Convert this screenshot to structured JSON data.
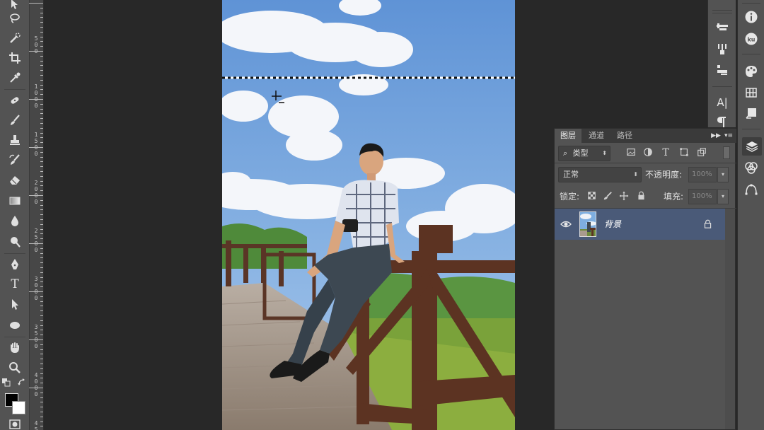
{
  "toolbar": {
    "tools": [
      "move-tool",
      "lasso-tool",
      "quick-selection-tool",
      "crop-tool",
      "eyedropper-tool",
      "spot-healing-tool",
      "brush-tool",
      "clone-stamp-tool",
      "history-brush-tool",
      "eraser-tool",
      "gradient-tool",
      "blur-tool",
      "dodge-tool",
      "pen-tool",
      "type-tool",
      "path-selection-tool",
      "ellipse-tool",
      "hand-tool",
      "zoom-tool"
    ],
    "type_tool_glyph": "T",
    "foreground_color": "#000000",
    "background_color": "#ffffff"
  },
  "ruler": {
    "labels": [
      "5\n0\n0",
      "1\n0\n0\n0",
      "1\n5\n0\n0",
      "2\n0\n0\n0",
      "2\n5\n0\n0",
      "3\n0\n0\n0",
      "3\n5\n0\n0",
      "4\n0\n0\n0",
      "4\n5\n0\n0"
    ]
  },
  "canvas": {
    "selection_marquee": "marching-ants horizontal line",
    "cursor": "crosshair"
  },
  "right_strip": {
    "char_panel_glyph": "A|",
    "info_glyph": "i",
    "kuler_glyph": "ku"
  },
  "layers_panel": {
    "tabs": [
      {
        "label": "图层",
        "active": true
      },
      {
        "label": "通道",
        "active": false
      },
      {
        "label": "路径",
        "active": false
      }
    ],
    "collapse_label": "▶▶",
    "menu_label": "▾≡",
    "filter": {
      "search_glyph": "⌕",
      "kind_label": "类型"
    },
    "filter_icons": [
      "image-filter-icon",
      "adjustment-filter-icon",
      "type-filter-icon",
      "shape-filter-icon",
      "smart-object-filter-icon"
    ],
    "blend_mode": "正常",
    "opacity_label": "不透明度:",
    "opacity_value": "100%",
    "lock_label": "锁定:",
    "fill_label": "填充:",
    "fill_value": "100%",
    "layers": [
      {
        "name": "背景",
        "visible": true,
        "locked": true
      }
    ]
  },
  "colors": {
    "selected_layer": "#4a5a78",
    "panel_bg": "#535353",
    "workspace_bg": "#282828"
  }
}
